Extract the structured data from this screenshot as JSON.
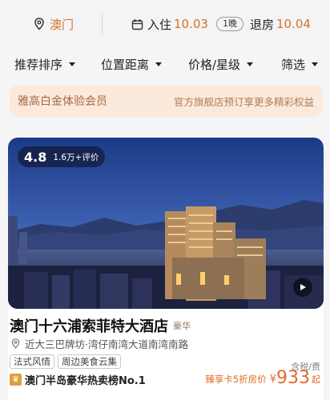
{
  "search": {
    "location": "澳门",
    "checkin_label": "入住",
    "checkin_date": "10.03",
    "nights": "1晚",
    "checkout_label": "退房",
    "checkout_date": "10.04"
  },
  "filters": [
    {
      "label": "推荐排序"
    },
    {
      "label": "位置距离"
    },
    {
      "label": "价格/星级"
    },
    {
      "label": "筛选"
    }
  ],
  "banner": {
    "left": "雅高白金体验会员",
    "right": "官方旗舰店预订享更多精彩权益"
  },
  "hotel": {
    "score": "4.8",
    "review_count": "1.6万+评价",
    "name": "澳门十六浦索菲特大酒店",
    "class_tag": "豪华",
    "address": "近大三巴牌坊·湾仔南湾大道南湾南路",
    "tags": [
      "法式风情",
      "周边美食云集"
    ],
    "tax_note": "含税/费",
    "rank_badge": "澳门半岛豪华热卖榜No.1",
    "promo": "臻享卡5折房价",
    "currency": "¥",
    "price": "933",
    "price_suffix": "起"
  },
  "colors": {
    "accent": "#d8731f",
    "banner_bg": "#fbe9dc",
    "price": "#e06b2a"
  },
  "icons": [
    "location-pin-icon",
    "calendar-icon",
    "play-icon",
    "map-pin-icon",
    "trophy-icon"
  ]
}
